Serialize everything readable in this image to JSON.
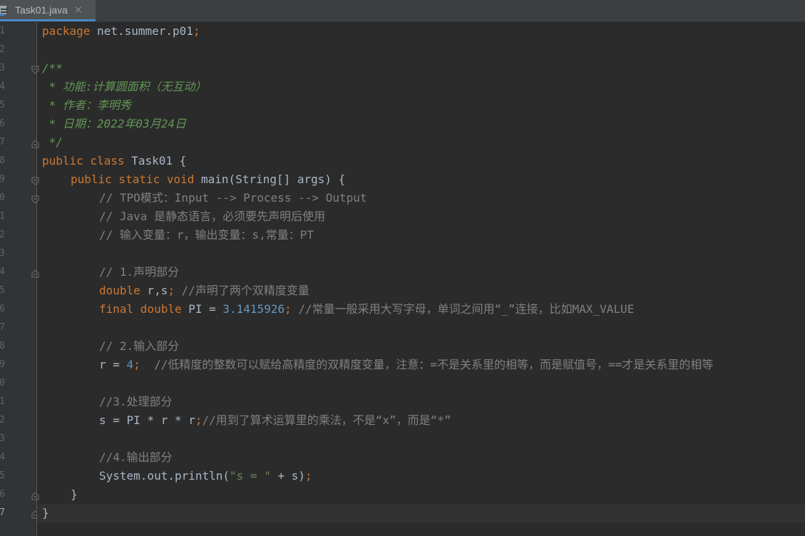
{
  "tab": {
    "filename": "Task01.java",
    "close_glyph": "×"
  },
  "gutter": {
    "line_numbers": [
      "1",
      "2",
      "3",
      "4",
      "5",
      "6",
      "7",
      "8",
      "9",
      "0",
      "1",
      "2",
      "3",
      "4",
      "5",
      "6",
      "7",
      "8",
      "9",
      "0",
      "1",
      "2",
      "3",
      "4",
      "5",
      "6",
      "7"
    ]
  },
  "code": {
    "l1_kw": "package",
    "l1_rest": " net.summer.p01",
    "l1_semi": ";",
    "l3": "/**",
    "l4": " * 功能:计算圆面积（无互动）",
    "l5": " * 作者：李明秀",
    "l6": " * 日期：2022年03月24日",
    "l7": " */",
    "l8_kw": "public class",
    "l8_rest": " Task01 {",
    "l9_kw": "public static void",
    "l9_rest": " main(String[] args) {",
    "l10": "// TPO模式：Input --> Process --> Output",
    "l11": "// Java 是静态语言，必须要先声明后使用",
    "l12": "// 输入变量：r，输出变量：s,常量：PT",
    "l14": "// 1.声明部分",
    "l15_kw": "double",
    "l15_rest": " r,s",
    "l15_semi": ";",
    "l15_cm": " //声明了两个双精度变量",
    "l16_kw": "final double",
    "l16_rest": " PI = ",
    "l16_num": "3.1415926",
    "l16_semi": ";",
    "l16_cm": " //常量一般采用大写字母，单词之间用“_”连接，比如MAX_VALUE",
    "l18": "// 2.输入部分",
    "l19_rest": "r = ",
    "l19_num": "4",
    "l19_semi": ";",
    "l19_cm": "  //低精度的整数可以赋给高精度的双精度变量，注意：=不是关系里的相等，而是赋值号，==才是关系里的相等",
    "l21": "//3.处理部分",
    "l22_rest": "s = PI * r * r",
    "l22_semi": ";",
    "l22_cm": "//用到了算术运算里的乘法，不是“x”，而是“*”",
    "l24": "//4.输出部分",
    "l25_a": "System.out.println(",
    "l25_str": "\"s = \"",
    "l25_b": " + s)",
    "l25_semi": ";",
    "l26": "}",
    "l27": "}"
  },
  "colors": {
    "background": "#2b2b2b",
    "keyword": "#cc7832",
    "comment": "#808080",
    "doc_comment": "#629755",
    "number": "#6897bb",
    "string": "#6a8759",
    "plain": "#a9b7c6"
  }
}
